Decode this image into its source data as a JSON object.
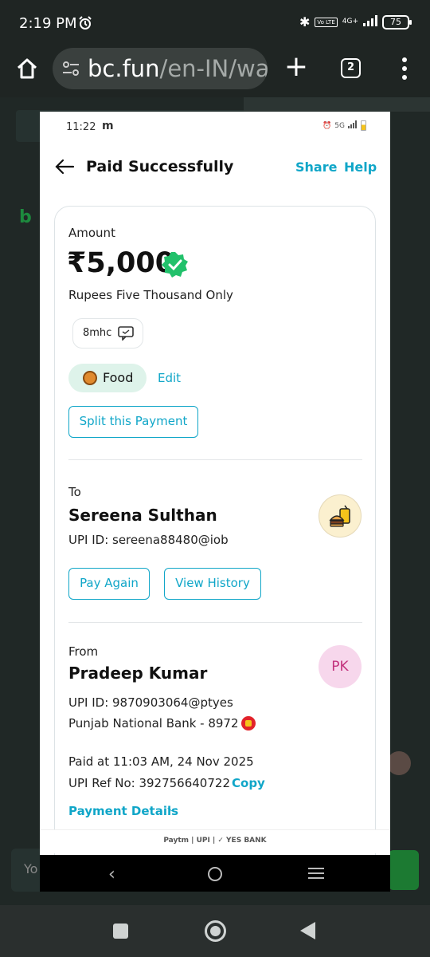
{
  "os_status": {
    "time": "2:19 PM",
    "volte": "Vo LTE",
    "network": "4G+",
    "battery": "75"
  },
  "browser": {
    "url_host": "bc.fun",
    "url_path": "/en-IN/wa",
    "tab_count": "2"
  },
  "background_page": {
    "input_placeholder": "Yo"
  },
  "inner_status": {
    "time": "11:22",
    "notif": "m",
    "network": "5G"
  },
  "header": {
    "title": "Paid Successfully",
    "share": "Share",
    "help": "Help"
  },
  "payment": {
    "amount_label": "Amount",
    "amount": "₹5,000",
    "amount_words": "Rupees Five Thousand Only",
    "note": "8mhc",
    "category": "Food",
    "edit": "Edit",
    "split_button": "Split this Payment"
  },
  "to": {
    "label": "To",
    "name": "Sereena Sulthan",
    "upi": "UPI ID: sereena88480@iob",
    "pay_again": "Pay Again",
    "view_history": "View History"
  },
  "from": {
    "label": "From",
    "name": "Pradeep Kumar",
    "initials": "PK",
    "upi": "UPI ID: 9870903064@ptyes",
    "bank": "Punjab National Bank - 8972"
  },
  "meta": {
    "paid_at": "Paid at 11:03 AM, 24 Nov 2025",
    "ref_no": "UPI Ref No: 392756640722",
    "copy": "Copy",
    "details": "Payment Details"
  },
  "footer": {
    "text": "Paytm | UPI | ✓ YES BANK"
  },
  "colors": {
    "accent": "#10a6c8",
    "verified": "#22c16b",
    "chip_bg": "#def3ea"
  }
}
